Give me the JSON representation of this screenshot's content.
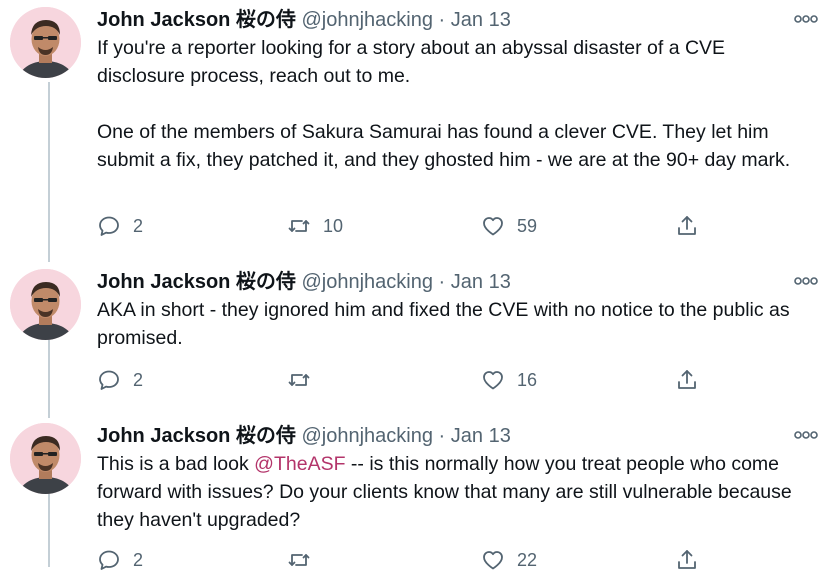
{
  "tweets": [
    {
      "display_name": "John Jackson 桜の侍",
      "handle": "@johnjhacking",
      "date": "Jan 13",
      "paragraphs": [
        "If you're a reporter looking for a story about an abyssal disaster of a CVE disclosure process, reach out to me.",
        "One of the members of Sakura Samurai has found a clever CVE. They let him submit a fix, they patched it, and they ghosted him - we are at the 90+ day mark."
      ],
      "replies": "2",
      "retweets": "10",
      "likes": "59"
    },
    {
      "display_name": "John Jackson 桜の侍",
      "handle": "@johnjhacking",
      "date": "Jan 13",
      "paragraphs": [
        "AKA in short - they ignored him and fixed the CVE with no notice to the public as promised."
      ],
      "replies": "2",
      "retweets": "",
      "likes": "16"
    },
    {
      "display_name": "John Jackson 桜の侍",
      "handle": "@johnjhacking",
      "date": "Jan 13",
      "text_before_mention": "This is a bad look ",
      "mention": "@TheASF",
      "text_after_mention": " -- is this normally how you treat people who come forward with issues? Do your clients know that many are still vulnerable because they haven't upgraded?",
      "replies": "2",
      "retweets": "",
      "likes": "22"
    }
  ],
  "separator": " · ",
  "icons": {
    "reply": "reply-icon",
    "retweet": "retweet-icon",
    "like": "heart-icon",
    "share": "share-icon",
    "more": "more-icon"
  },
  "colors": {
    "text": "#0f1419",
    "muted": "#536471",
    "mention": "#b3346a",
    "thread_line": "#c4cfd6"
  }
}
